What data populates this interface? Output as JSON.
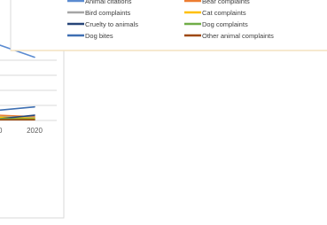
{
  "chart_data": {
    "type": "line",
    "x": [
      "2020"
    ],
    "ylim": [
      0,
      4
    ],
    "grid": true,
    "legend_position": "top",
    "series": [
      {
        "name": "Animal citations",
        "color": "#5b8bd1",
        "values": [
          4.2
        ]
      },
      {
        "name": "Bear complaints",
        "color": "#ed7d31",
        "values": [
          0.25
        ]
      },
      {
        "name": "Bird complaints",
        "color": "#a5a5a5",
        "values": [
          0.2
        ]
      },
      {
        "name": "Cat complaints",
        "color": "#ffc000",
        "values": [
          0.15
        ]
      },
      {
        "name": "Cruelty to animals",
        "color": "#264478",
        "values": [
          0.35
        ]
      },
      {
        "name": "Dog complaints",
        "color": "#70ad47",
        "values": [
          0.1
        ]
      },
      {
        "name": "Dog bites",
        "color": "#3e6fb2",
        "values": [
          0.9
        ]
      },
      {
        "name": "Other animal complaints",
        "color": "#9e480e",
        "values": [
          0.05
        ]
      }
    ]
  }
}
